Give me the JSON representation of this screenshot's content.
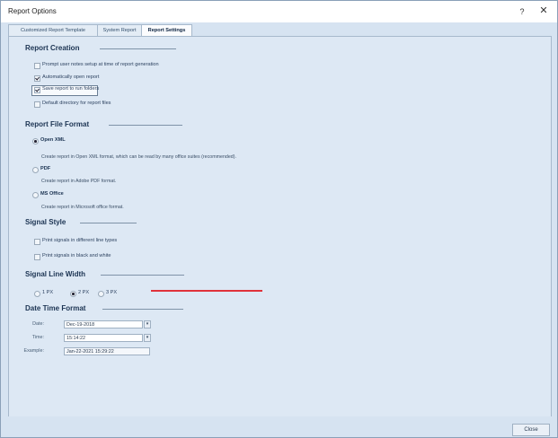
{
  "window": {
    "title": "Report Options",
    "help_label": "?",
    "close_glyph": "✕"
  },
  "tabs": [
    {
      "label": "Customized Report Template"
    },
    {
      "label": "System Report"
    },
    {
      "label": "Report Settings",
      "active": true
    }
  ],
  "report_creation": {
    "heading": "Report Creation",
    "options": [
      {
        "label": "Prompt user notes setup at time of report generation",
        "checked": false
      },
      {
        "label": "Automatically open report",
        "checked": true
      },
      {
        "label": "Save report to run folders",
        "checked": true
      },
      {
        "label": "Default directory for report files",
        "checked": false
      }
    ]
  },
  "report_file_format": {
    "heading": "Report File Format",
    "formats": [
      {
        "name": "Open XML",
        "selected": true,
        "description": "Create report in Open XML format, which can be read by many office suites (recommended)."
      },
      {
        "name": "PDF",
        "selected": false,
        "description": "Create report in Adobe PDF format."
      },
      {
        "name": "MS Office",
        "selected": false,
        "description": "Create report in Microsoft office format."
      }
    ]
  },
  "signal_style": {
    "heading": "Signal Style",
    "options": [
      {
        "label": "Print signals in different line types",
        "checked": false
      },
      {
        "label": "Print signals in black and white",
        "checked": false
      }
    ]
  },
  "signal_line_width": {
    "heading": "Signal Line Width",
    "options": [
      {
        "label": "1 PX",
        "selected": false
      },
      {
        "label": "2 PX",
        "selected": true
      },
      {
        "label": "3 PX",
        "selected": false
      }
    ]
  },
  "date_time_format": {
    "heading": "Date Time Format",
    "date_label": "Date:",
    "date_value": "Dec-19-2018",
    "time_label": "Time:",
    "time_value": "15:14:22",
    "example_label": "Example:",
    "example_value": "Jan-22-2021 15:29:22"
  },
  "footer": {
    "close_label": "Close"
  },
  "colors": {
    "panel_bg": "#dde8f4",
    "accent_line": "#e0323a"
  }
}
